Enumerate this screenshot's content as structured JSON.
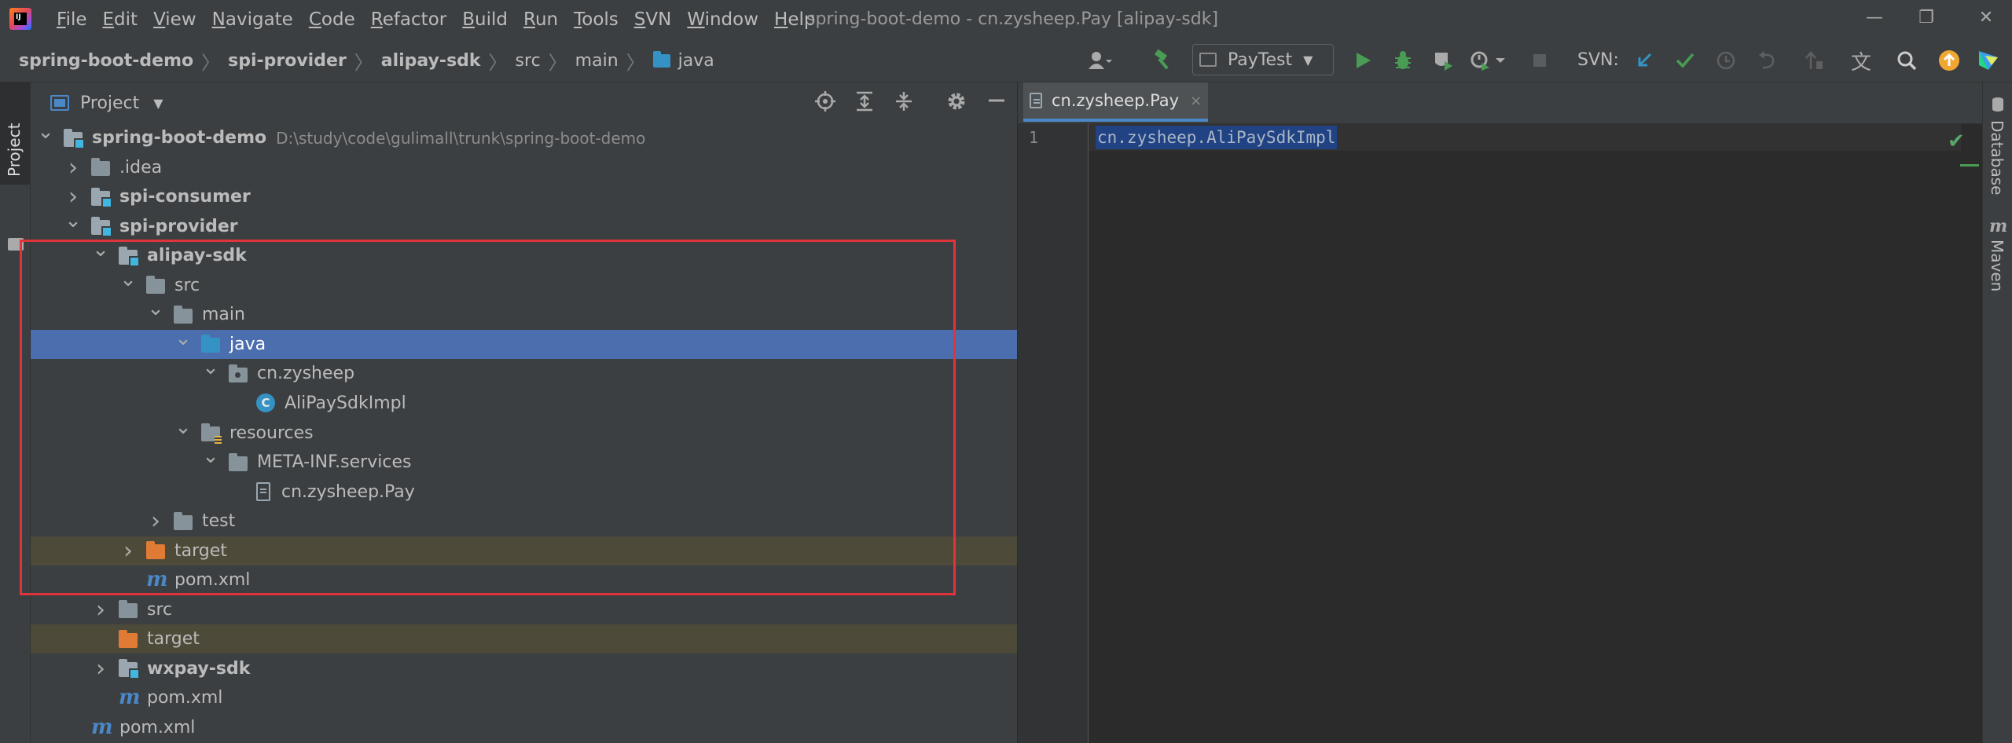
{
  "title_bar": {
    "menu": [
      "File",
      "Edit",
      "View",
      "Navigate",
      "Code",
      "Refactor",
      "Build",
      "Run",
      "Tools",
      "SVN",
      "Window",
      "Help"
    ],
    "window_title": "spring-boot-demo - cn.zysheep.Pay [alipay-sdk]",
    "controls": {
      "minimize": "—",
      "restore": "❐",
      "close": "✕"
    }
  },
  "breadcrumb": [
    "spring-boot-demo",
    "spi-provider",
    "alipay-sdk",
    "src",
    "main",
    "java"
  ],
  "toolbar": {
    "run_config": "PayTest",
    "svn_label": "SVN:",
    "icons": [
      "user-icon",
      "build-hammer-icon",
      "run-icon",
      "debug-icon",
      "coverage-icon",
      "profile-icon",
      "stop-icon",
      "svn-update-icon",
      "svn-commit-icon",
      "history-icon",
      "revert-icon",
      "push-icon",
      "translate-icon",
      "search-icon",
      "update-icon",
      "jetbrains-icon"
    ],
    "colors": {
      "run": "#499c54",
      "svn_update": "#3592c4",
      "update_badge": "#f0a732"
    }
  },
  "left_strip": {
    "project_tab": "Project"
  },
  "project_panel": {
    "title": "Project",
    "tree": [
      {
        "label": "spring-boot-demo",
        "path": "D:\\study\\code\\gulimall\\trunk\\spring-boot-demo",
        "level": 0,
        "expanded": true,
        "icon": "module-folder",
        "bold": true
      },
      {
        "label": ".idea",
        "level": 1,
        "expanded": false,
        "icon": "folder"
      },
      {
        "label": "spi-consumer",
        "level": 1,
        "expanded": false,
        "icon": "module-folder",
        "bold": true
      },
      {
        "label": "spi-provider",
        "level": 1,
        "expanded": true,
        "icon": "module-folder",
        "bold": true
      },
      {
        "label": "alipay-sdk",
        "level": 2,
        "expanded": true,
        "icon": "module-folder",
        "bold": true
      },
      {
        "label": "src",
        "level": 3,
        "expanded": true,
        "icon": "folder"
      },
      {
        "label": "main",
        "level": 4,
        "expanded": true,
        "icon": "folder"
      },
      {
        "label": "java",
        "level": 5,
        "expanded": true,
        "icon": "source-folder",
        "selected": true
      },
      {
        "label": "cn.zysheep",
        "level": 6,
        "expanded": true,
        "icon": "package"
      },
      {
        "label": "AliPaySdkImpl",
        "level": 7,
        "icon": "class"
      },
      {
        "label": "resources",
        "level": 5,
        "expanded": true,
        "icon": "resources-folder"
      },
      {
        "label": "META-INF.services",
        "level": 6,
        "expanded": true,
        "icon": "folder"
      },
      {
        "label": "cn.zysheep.Pay",
        "level": 7,
        "icon": "text-file"
      },
      {
        "label": "test",
        "level": 4,
        "expanded": false,
        "icon": "folder"
      },
      {
        "label": "target",
        "level": 3,
        "expanded": false,
        "icon": "excluded-folder",
        "excluded": true
      },
      {
        "label": "pom.xml",
        "level": 3,
        "icon": "maven"
      },
      {
        "label": "src",
        "level": 2,
        "expanded": false,
        "icon": "folder"
      },
      {
        "label": "target",
        "level": 2,
        "icon": "excluded-folder",
        "excluded": true
      },
      {
        "label": "wxpay-sdk",
        "level": 2,
        "expanded": false,
        "icon": "module-folder",
        "bold": true
      },
      {
        "label": "pom.xml",
        "level": 2,
        "icon": "maven"
      },
      {
        "label": "pom.xml",
        "level": 1,
        "icon": "maven"
      }
    ],
    "highlight_color": "#e0343c"
  },
  "editor": {
    "tab": "cn.zysheep.Pay",
    "tab_close": "×",
    "line_number": "1",
    "code": "cn.zysheep.AliPaySdkImpl"
  },
  "right_strip": {
    "database": "Database",
    "maven": "Maven",
    "maven_glyph": "m"
  }
}
